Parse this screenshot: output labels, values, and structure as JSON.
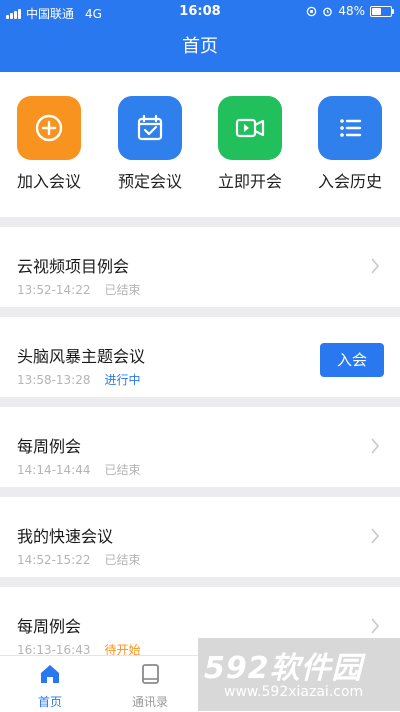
{
  "status_bar": {
    "carrier": "中国联通",
    "network": "4G",
    "time": "16:08",
    "battery": "48%",
    "battery_level": 0.48
  },
  "header": {
    "title": "首页"
  },
  "quick_actions": [
    {
      "label": "加入会议",
      "icon": "plus-circle-icon",
      "color": "#f7931e"
    },
    {
      "label": "预定会议",
      "icon": "calendar-check-icon",
      "color": "#2f80ed"
    },
    {
      "label": "立即开会",
      "icon": "video-camera-icon",
      "color": "#21c05c"
    },
    {
      "label": "入会历史",
      "icon": "list-icon",
      "color": "#2f80ed"
    }
  ],
  "meetings": [
    {
      "title": "云视频项目例会",
      "time": "13:52-14:22",
      "status": "已结束",
      "status_color": "#b5b5b5"
    },
    {
      "title": "头脑风暴主题会议",
      "time": "13:58-13:28",
      "status": "进行中",
      "status_color": "#2a78f0",
      "action": "入会"
    },
    {
      "title": "每周例会",
      "time": "14:14-14:44",
      "status": "已结束",
      "status_color": "#b5b5b5"
    },
    {
      "title": "我的快速会议",
      "time": "14:52-15:22",
      "status": "已结束",
      "status_color": "#b5b5b5"
    },
    {
      "title": "每周例会",
      "time": "16:13-16:43",
      "status": "待开始",
      "status_color": "#f7931e"
    }
  ],
  "tabbar": {
    "home": "首页",
    "contacts": "通讯录"
  },
  "watermark": {
    "big": "592软件园",
    "small": "www.592xiazai.com"
  },
  "colors": {
    "primary": "#2a78f0",
    "background": "#f2f3f5"
  }
}
